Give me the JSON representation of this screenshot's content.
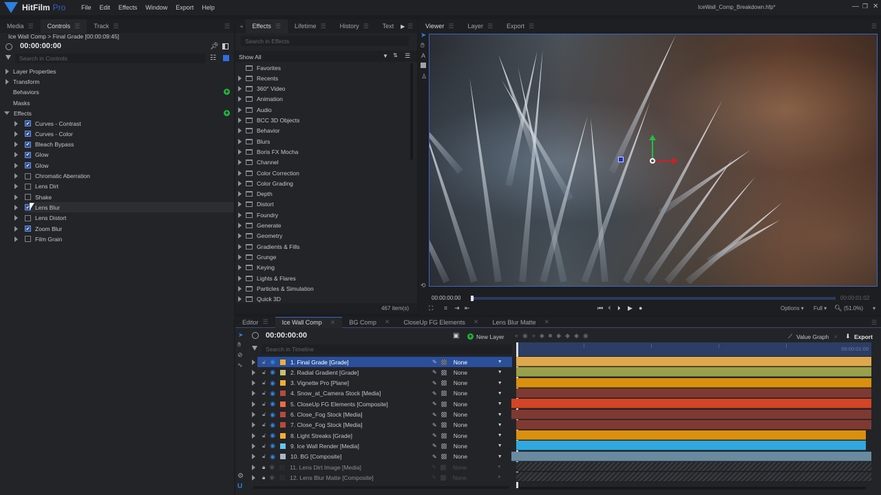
{
  "app": {
    "name": "HitFilm",
    "edition": "Pro",
    "document_title": "IceWall_Comp_Breakdown.hfp*",
    "menu": [
      "File",
      "Edit",
      "Effects",
      "Window",
      "Export",
      "Help"
    ],
    "window_controls": {
      "minimize": "—",
      "maximize": "❐",
      "close": "✕"
    }
  },
  "left_panel": {
    "tabs": [
      {
        "label": "Media"
      },
      {
        "label": "Controls",
        "active": true
      },
      {
        "label": "Track"
      }
    ],
    "breadcrumb": "Ice Wall Comp > Final Grade [00:00:09:45]",
    "timecode": "00:00:00:00",
    "search_placeholder": "Search in Controls",
    "sections": [
      {
        "label": "Layer Properties"
      },
      {
        "label": "Transform"
      },
      {
        "label": "Behaviors"
      },
      {
        "label": "Masks"
      },
      {
        "label": "Effects"
      }
    ],
    "effects": [
      {
        "label": "Curves - Contrast",
        "enabled": true
      },
      {
        "label": "Curves - Color",
        "enabled": true
      },
      {
        "label": "Bleach Bypass",
        "enabled": true
      },
      {
        "label": "Glow",
        "enabled": true
      },
      {
        "label": "Glow",
        "enabled": true
      },
      {
        "label": "Chromatic Aberration",
        "enabled": false
      },
      {
        "label": "Lens Dirt",
        "enabled": false
      },
      {
        "label": "Shake",
        "enabled": false
      },
      {
        "label": "Lens Blur",
        "enabled": true,
        "hovered": true
      },
      {
        "label": "Lens Distort",
        "enabled": false
      },
      {
        "label": "Zoom Blur",
        "enabled": true
      },
      {
        "label": "Film Grain",
        "enabled": false
      }
    ]
  },
  "effects_panel": {
    "tabs": [
      {
        "label": "Effects",
        "active": true
      },
      {
        "label": "Lifetime"
      },
      {
        "label": "History"
      },
      {
        "label": "Text"
      }
    ],
    "search_placeholder": "Search in Effects",
    "filter": "Show All",
    "folders": [
      "Favorites",
      "Recents",
      "360° Video",
      "Animation",
      "Audio",
      "BCC 3D Objects",
      "Behavior",
      "Blurs",
      "Boris FX Mocha",
      "Channel",
      "Color Correction",
      "Color Grading",
      "Depth",
      "Distort",
      "Foundry",
      "Generate",
      "Geometry",
      "Gradients & Fills",
      "Grunge",
      "Keying",
      "Lights & Flares",
      "Particles & Simulation",
      "Quick 3D"
    ],
    "item_count": "467 item(s)"
  },
  "viewer": {
    "tabs": [
      {
        "label": "Viewer",
        "active": true
      },
      {
        "label": "Layer"
      },
      {
        "label": "Export"
      }
    ],
    "current_time": "00:00:00:00",
    "end_time": "00:00:01:02",
    "playhead_progress": 0.0,
    "options_label": "Options",
    "quality_label": "Full",
    "zoom_label": "(51.0%)"
  },
  "timeline": {
    "tabs": [
      {
        "label": "Editor"
      },
      {
        "label": "Ice Wall Comp",
        "active": true
      },
      {
        "label": "BG Comp"
      },
      {
        "label": "CloseUp FG Elements"
      },
      {
        "label": "Lens Blur Matte"
      }
    ],
    "timecode": "00:00:00:00",
    "new_layer_label": "New Layer",
    "value_graph_label": "Value Graph",
    "export_label": "Export",
    "search_placeholder": "Search in Timeline",
    "ruler_end": "00:00:01:00",
    "layers": [
      {
        "name": "1. Final Grade [Grade]",
        "color": "#f0b030",
        "bar": "#e0a84e",
        "blend": "None",
        "selected": true
      },
      {
        "name": "2. Radial Gradient [Grade]",
        "color": "#c8c070",
        "bar": "#9aa04a",
        "blend": "None"
      },
      {
        "name": "3. Vignette Pro [Plane]",
        "color": "#f0b030",
        "bar": "#d9900e",
        "blend": "None"
      },
      {
        "name": "4. Snow_at_Camera Stock [Media]",
        "color": "#b84a3c",
        "bar": "#7e3a32",
        "blend": "None"
      },
      {
        "name": "5. CloseUp FG Elements [Composite]",
        "color": "#f06a40",
        "bar": "#d44426",
        "blend": "None"
      },
      {
        "name": "6. Close_Fog Stock [Media]",
        "color": "#b84a3c",
        "bar": "#7e3a32",
        "blend": "None"
      },
      {
        "name": "7. Close_Fog Stock [Media]",
        "color": "#b84a3c",
        "bar": "#7e3a32",
        "blend": "None"
      },
      {
        "name": "8. Light Streaks [Grade]",
        "color": "#f0b030",
        "bar": "#d9900e",
        "blend": "None"
      },
      {
        "name": "9. Ice Wall Render [Media]",
        "color": "#60c8f0",
        "bar": "#2fa8e0",
        "blend": "None"
      },
      {
        "name": "10. BG [Composite]",
        "color": "#a8b8c8",
        "bar": "#6a8aa0",
        "blend": "None"
      },
      {
        "name": "11. Lens Dirt Image [Media]",
        "color": "#2a2b2e",
        "bar": "hatch",
        "blend": "None",
        "disabled": true
      },
      {
        "name": "12. Lens Blur Matte [Composite]",
        "color": "#2a2b2e",
        "bar": "hatch",
        "blend": "None",
        "disabled": true
      }
    ]
  },
  "icons": {
    "clock": "clock-icon",
    "filter": "filter-icon",
    "pin": "pin-icon",
    "folder": "folder-icon",
    "eye": "eye-icon",
    "lock": "lock-icon",
    "pencil": "pencil-icon",
    "checker": "matte-icon"
  }
}
